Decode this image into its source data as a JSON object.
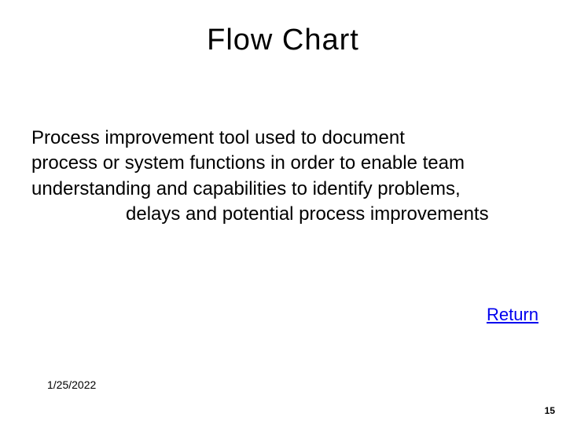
{
  "title": "Flow Chart",
  "body": {
    "line1": "Process improvement tool used to document",
    "line2": "process or system functions in order to enable team",
    "line3": "understanding and capabilities to identify problems,",
    "line4": "delays and potential process improvements"
  },
  "return_label": "Return",
  "footer": {
    "date": "1/25/2022",
    "page_number": "15"
  }
}
